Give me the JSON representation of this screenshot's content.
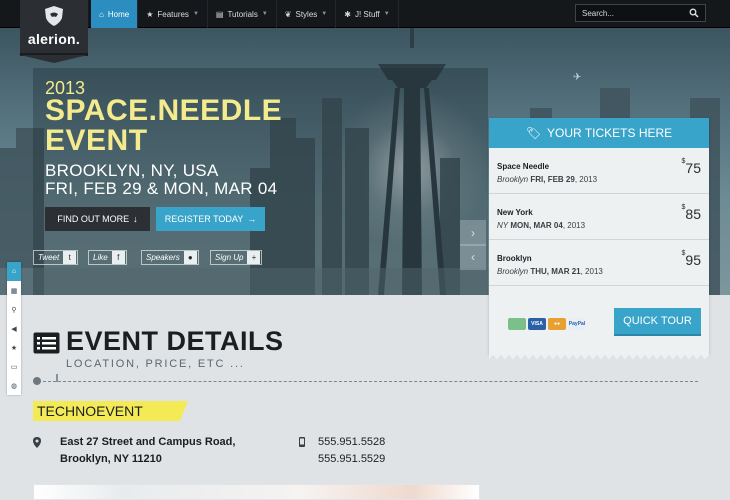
{
  "brand": {
    "name": "alerion.",
    "icon": "shield-logo-icon"
  },
  "nav": {
    "items": [
      {
        "label": "Home",
        "icon": "home-icon",
        "active": true,
        "dropdown": false
      },
      {
        "label": "Features",
        "icon": "star-icon",
        "active": false,
        "dropdown": true
      },
      {
        "label": "Tutorials",
        "icon": "document-icon",
        "active": false,
        "dropdown": true
      },
      {
        "label": "Styles",
        "icon": "leaf-icon",
        "active": false,
        "dropdown": true
      },
      {
        "label": "J! Stuff",
        "icon": "joomla-icon",
        "active": false,
        "dropdown": true
      }
    ],
    "search_placeholder": "Search..."
  },
  "hero": {
    "year": "2013",
    "title_line1": "SPACE.NEEDLE",
    "title_line2": "EVENT",
    "location": "BROOKLYN, NY, USA",
    "dates": "FRI, FEB 29 & MON, MAR 04",
    "btn_more": "FIND OUT MORE",
    "btn_register": "REGISTER TODAY",
    "social": [
      {
        "label": "Tweet",
        "icon": "twitter-icon",
        "glyph": "t"
      },
      {
        "label": "Like",
        "icon": "facebook-icon",
        "glyph": "f"
      },
      {
        "label": "Speakers",
        "icon": "user-icon",
        "glyph": "●"
      },
      {
        "label": "Sign Up",
        "icon": "plus-icon",
        "glyph": "+"
      }
    ]
  },
  "tickets": {
    "heading": "YOUR TICKETS HERE",
    "rows": [
      {
        "name": "Space Needle",
        "city": "Brooklyn",
        "day": "FRI, FEB 29",
        "year": ", 2013",
        "currency": "$",
        "price": "75"
      },
      {
        "name": "New York",
        "city": "NY",
        "day": "MON, MAR 04",
        "year": ", 2013",
        "currency": "$",
        "price": "85"
      },
      {
        "name": "Brooklyn",
        "city": "Brooklyn",
        "day": "THU, MAR 21",
        "year": ", 2013",
        "currency": "$",
        "price": "95"
      }
    ],
    "payment_icons": [
      "cash-icon",
      "visa-icon",
      "mastercard-icon",
      "paypal-icon"
    ],
    "tour_label": "QUICK TOUR"
  },
  "sidebar_tools": [
    "home-icon",
    "calendar-icon",
    "location-icon",
    "megaphone-icon",
    "star-icon",
    "monitor-icon",
    "globe-icon"
  ],
  "event": {
    "title": "EVENT DETAILS",
    "subtitle": "LOCATION, PRICE, ETC ...",
    "tag": "TECHNOEVENT",
    "address_line1": "East 27 Street and Campus Road,",
    "address_line2": "Brooklyn, NY 11210",
    "phone1": "555.951.5528",
    "phone2": "555.951.5529"
  },
  "colors": {
    "accent": "#39a4c9",
    "highlight": "#f4ea56",
    "title_yellow": "#f4ea8e",
    "nav_bg": "#15181b"
  }
}
